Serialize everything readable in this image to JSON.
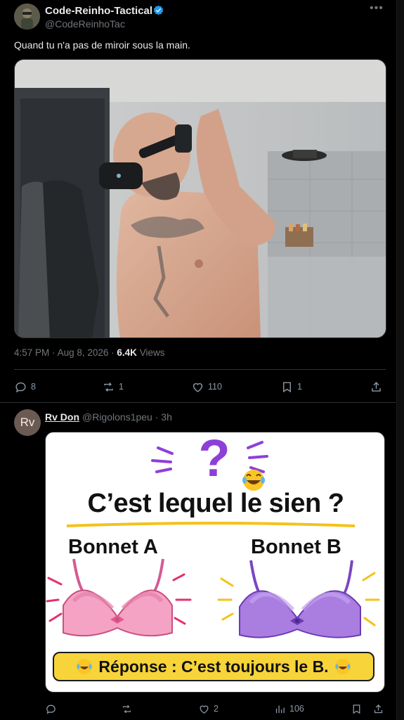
{
  "post1": {
    "author_name": "Code-Reinho-Tactical",
    "author_handle": "@CodeReinhoTac",
    "text": "Quand tu n'a pas de miroir sous la main.",
    "time": "4:57 PM",
    "date": "Aug 8, 2026",
    "views_count": "6.4K",
    "views_label": "Views",
    "replies": "8",
    "reposts": "1",
    "likes": "110",
    "bookmarks": "1"
  },
  "post2": {
    "avatar_initials": "Rv",
    "author_name": "Rv Don",
    "author_handle": "@Rigolons1peu",
    "age": "3h",
    "likes": "2",
    "views": "106",
    "meme": {
      "question_mark": "?",
      "title": "C’est lequel le sien ?",
      "label_a": "Bonnet A",
      "label_b": "Bonnet B",
      "answer": "Réponse : C’est toujours le B."
    }
  },
  "colors": {
    "background": "#000000",
    "text_primary": "#e7e9ea",
    "text_secondary": "#71767b",
    "verified": "#1d9bf0",
    "bra_a": "#f5a3c4",
    "bra_b": "#a97ee0",
    "answer_banner": "#f7d43a"
  },
  "icons": [
    "verified-badge-icon",
    "more-icon",
    "reply-icon",
    "repost-icon",
    "like-icon",
    "bookmark-icon",
    "share-icon",
    "views-icon"
  ]
}
